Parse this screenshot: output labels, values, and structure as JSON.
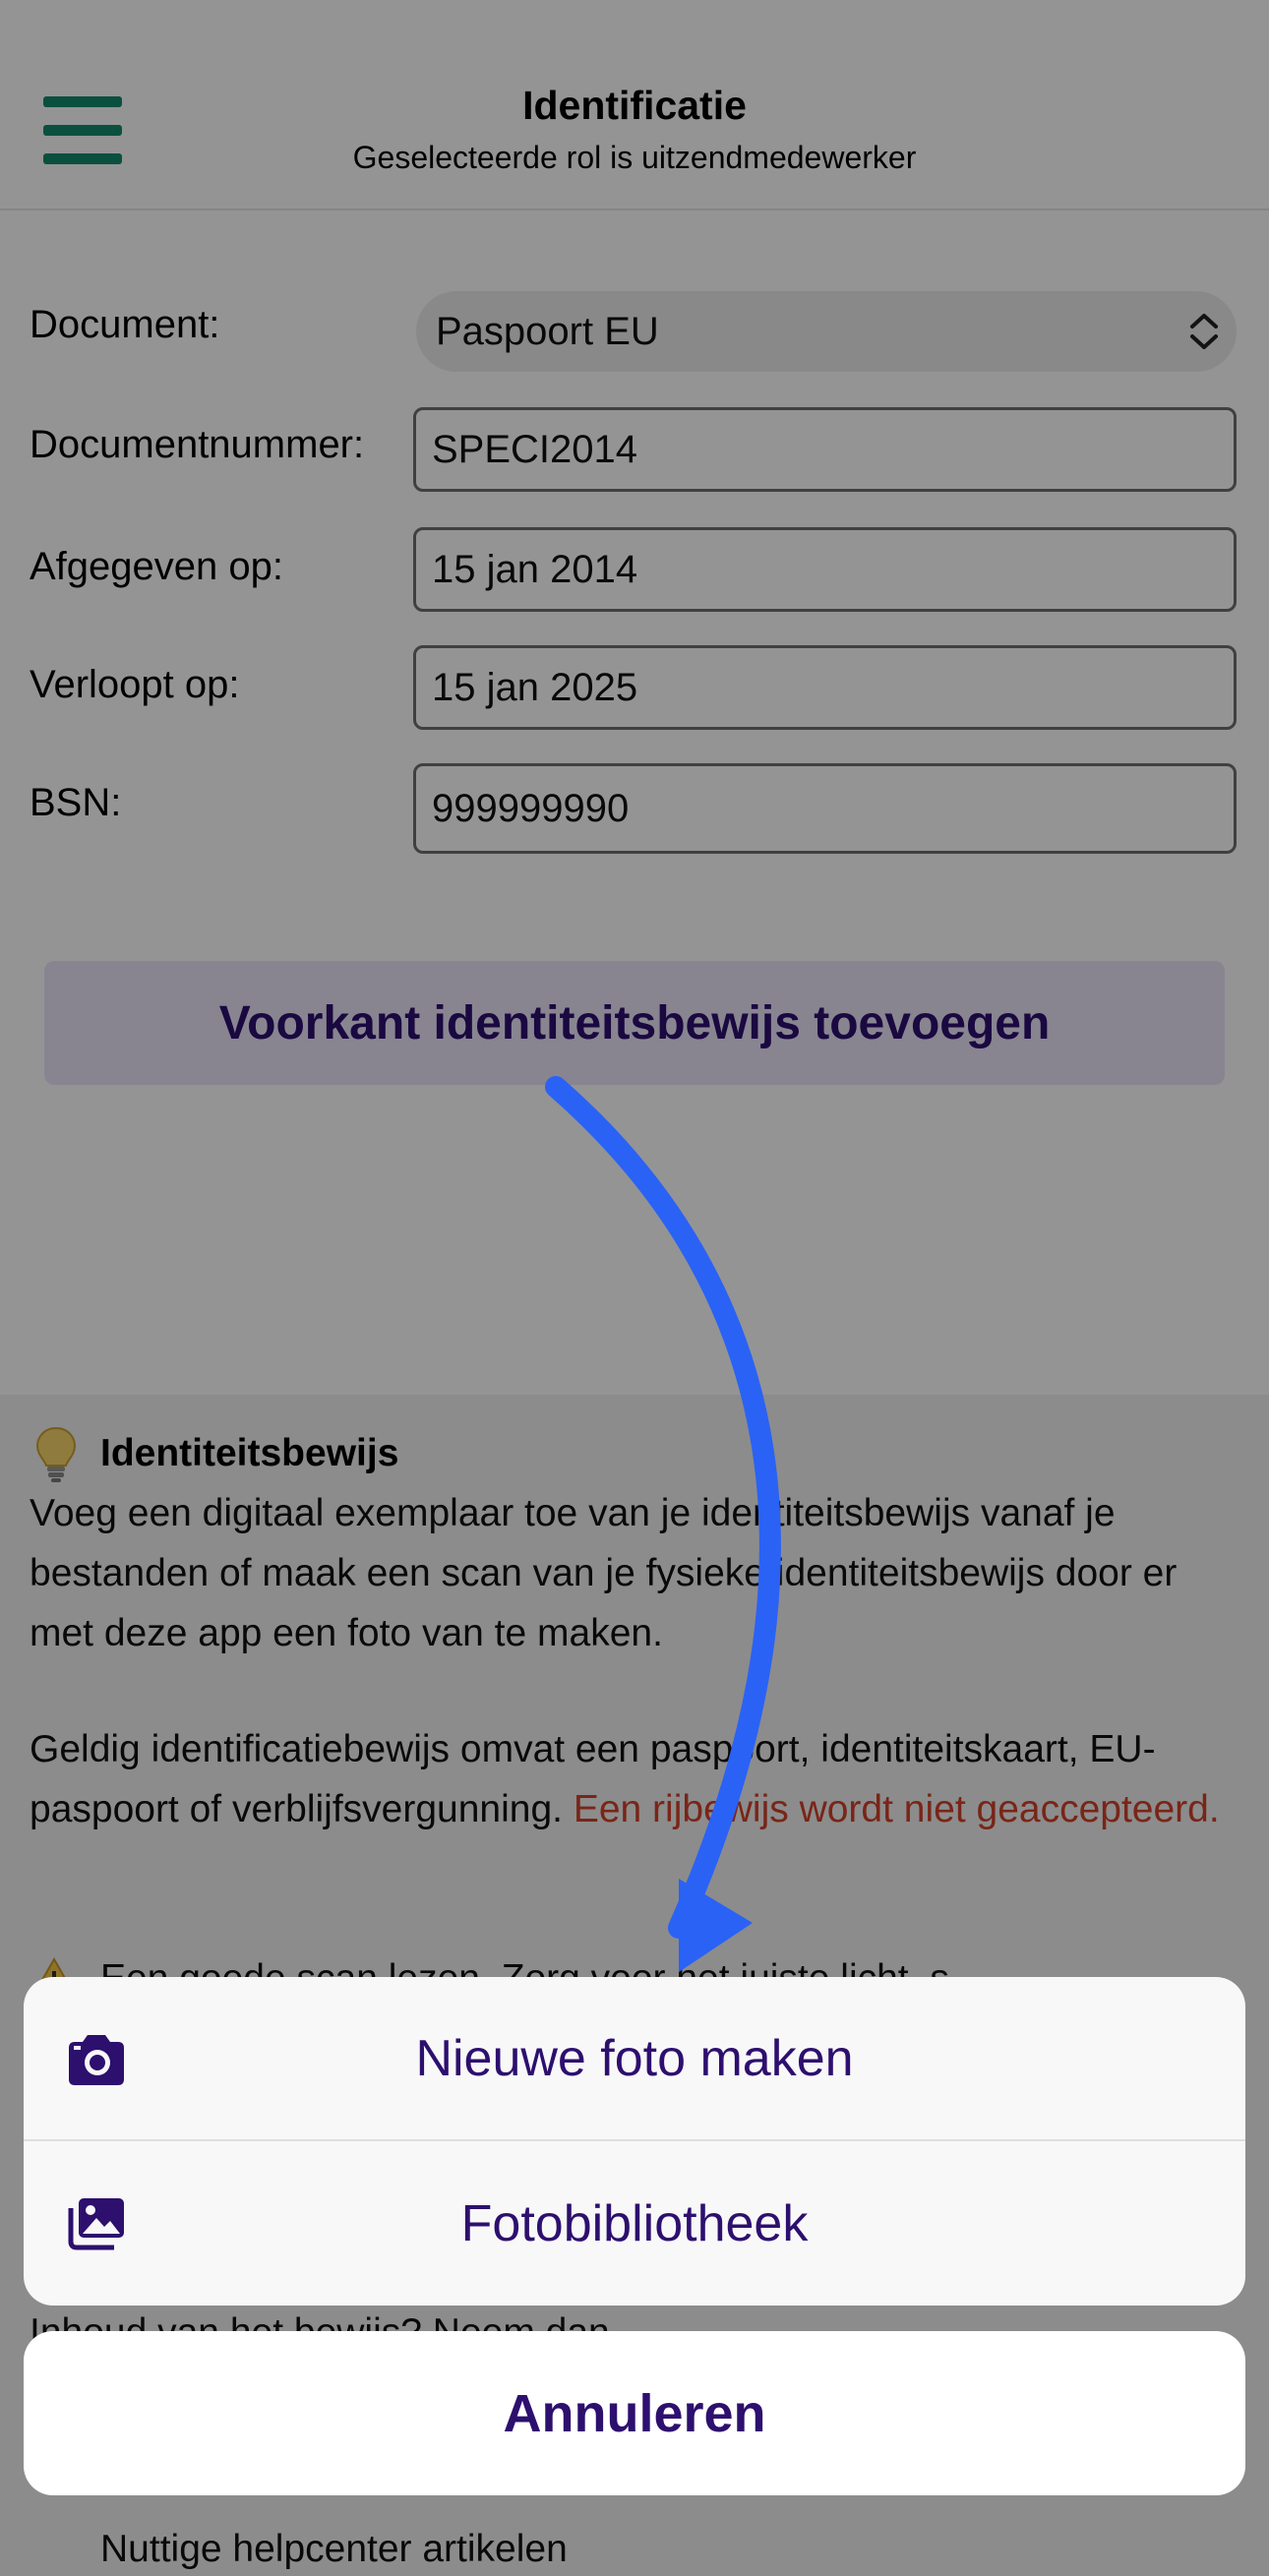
{
  "colors": {
    "accent_green": "#138a6d",
    "brand_purple": "#2d0f6e",
    "arrow_blue": "#2a62f5",
    "warning_red": "#d0402a"
  },
  "header": {
    "title": "Identificatie",
    "subtitle": "Geselecteerde rol is uitzendmedewerker",
    "menu_icon": "hamburger-menu-icon"
  },
  "form": {
    "document_label": "Document:",
    "document_value": "Paspoort EU",
    "documentnummer_label": "Documentnummer:",
    "documentnummer_value": "SPECI2014",
    "afgegeven_label": "Afgegeven op:",
    "afgegeven_value": "15 jan 2014",
    "verloopt_label": "Verloopt op:",
    "verloopt_value": "15 jan 2025",
    "bsn_label": "BSN:",
    "bsn_value": "999999990"
  },
  "add_front_button": "Voorkant identiteitsbewijs toevoegen",
  "info": {
    "title": "Identiteitsbewijs",
    "para1": "Voeg een digitaal exemplaar toe van je identiteitsbewijs vanaf je bestanden of maak een scan van je fysieke identiteitsbewijs door er met deze app een foto van te maken.",
    "para2": "Geldig identificatiebewijs omvat een paspoort, identiteitskaart, EU-paspoort of verblijfsvergunning.",
    "para2_warning": "Een rijbewijs wordt niet geaccepteerd.",
    "partial_warning": "Een goede scan lezen, Zorg voor het juiste licht, s",
    "partial_help": "Inhoud van het bewijs? Neem dan",
    "partial_helpcenter": "Nuttige helpcenter artikelen"
  },
  "action_sheet": {
    "new_photo": "Nieuwe foto maken",
    "photo_library": "Fotobibliotheek",
    "cancel": "Annuleren"
  }
}
